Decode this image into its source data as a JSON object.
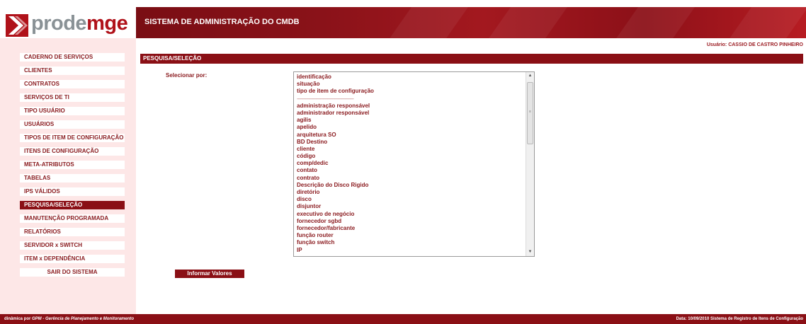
{
  "header": {
    "logo_part1": "prode",
    "logo_part2": "mge",
    "title": "SISTEMA DE ADMINISTRAÇÃO DO CMDB"
  },
  "user_line": "Usuário: CASSIO DE CASTRO PINHEIRO",
  "sidebar": {
    "items": [
      {
        "label": "CADERNO DE SERVIÇOS"
      },
      {
        "label": "CLIENTES"
      },
      {
        "label": "CONTRATOS"
      },
      {
        "label": "SERVIÇOS DE TI"
      },
      {
        "label": "TIPO USUÁRIO"
      },
      {
        "label": "USUÁRIOS"
      },
      {
        "label": "TIPOS DE ITEM DE CONFIGURAÇÃO"
      },
      {
        "label": "ITENS DE CONFIGURAÇÃO"
      },
      {
        "label": "META-ATRIBUTOS"
      },
      {
        "label": "TABELAS"
      },
      {
        "label": "IPS VÁLIDOS"
      },
      {
        "label": "PESQUISA/SELEÇÃO"
      },
      {
        "label": "MANUTENÇÃO PROGRAMADA"
      },
      {
        "label": "RELATÓRIOS"
      },
      {
        "label": "SERVIDOR x SWITCH"
      },
      {
        "label": "ITEM x DEPENDÊNCIA"
      },
      {
        "label": "SAIR DO SISTEMA"
      }
    ]
  },
  "main": {
    "section_title": "PESQUISA/SELEÇÃO",
    "select_label": "Selecionar por:",
    "options": [
      "identificação",
      "situação",
      "tipo de item de configuração",
      "------------------------------------------------",
      "administração responsável",
      "administrador responsável",
      "agilis",
      "apelido",
      "arquitetura SO",
      "BD Destino",
      "cliente",
      "código",
      "comp/dedic",
      "contato",
      "contrato",
      "Descrição do Disco Rigido",
      "diretório",
      "disco",
      "disjuntor",
      "executivo de negócio",
      "fornecedor sgbd",
      "fornecedor/fabricante",
      "função router",
      "função switch",
      "IP"
    ],
    "submit_label": "Informar Valores"
  },
  "footer": {
    "left_prefix": "dinâmica por ",
    "left_org": "GPM - Gerência de Planejamento e Monitoramento",
    "right_text": "Data: 10/09/2010  Sistema de Registro de Itens de Configuração"
  },
  "colors": {
    "brand_red": "#8a0f15",
    "sidebar_bg": "#fde7e7",
    "text_red": "#8a1a1e"
  }
}
